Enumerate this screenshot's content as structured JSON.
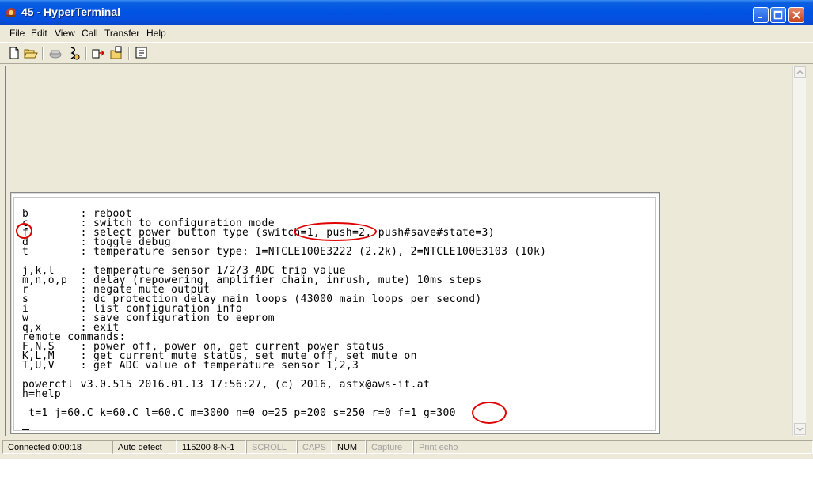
{
  "window": {
    "title": "45 - HyperTerminal"
  },
  "menu": [
    "File",
    "Edit",
    "View",
    "Call",
    "Transfer",
    "Help"
  ],
  "toolbar": {
    "icons": [
      "new-icon",
      "open-icon",
      "disconnect-icon",
      "connect-icon",
      "send-icon",
      "receive-icon",
      "properties-icon"
    ]
  },
  "terminal": {
    "lines": [
      "b        : reboot",
      "c        : switch to configuration mode",
      "f        : select power button type (switch=1, push=2, push#save#state=3)",
      "d        : toggle debug",
      "t        : temperature sensor type: 1=NTCLE100E3222 (2.2k), 2=NTCLE100E3103 (10k)",
      "",
      "j,k,l    : temperature sensor 1/2/3 ADC trip value",
      "m,n,o,p  : delay (repowering, amplifier chain, inrush, mute) 10ms steps",
      "r        : negate mute output",
      "s        : dc protection delay main loops (43000 main loops per second)",
      "i        : list configuration info",
      "w        : save configuration to eeprom",
      "q,x      : exit",
      "remote commands:",
      "F,N,S    : power off, power on, get current power status",
      "K,L,M    : get current mute status, set mute off, set mute on",
      "T,U,V    : get ADC value of temperature sensor 1,2,3",
      "",
      "powerctl v3.0.515 2016.01.13 17:56:27, (c) 2016, astx@aws-it.at",
      "h=help",
      "",
      " t=1 j=60.C k=60.C l=60.C m=3000 n=0 o=25 p=200 s=250 r=0 f=1 g=300"
    ]
  },
  "status": {
    "connected": "Connected 0:00:18",
    "detect": "Auto detect",
    "settings": "115200 8-N-1",
    "scroll": "SCROLL",
    "caps": "CAPS",
    "num": "NUM",
    "capture": "Capture",
    "print_echo": "Print echo"
  },
  "colors": {
    "titlebar": "#0054e3",
    "annotation": "#e00000",
    "chrome": "#ece9d8"
  }
}
